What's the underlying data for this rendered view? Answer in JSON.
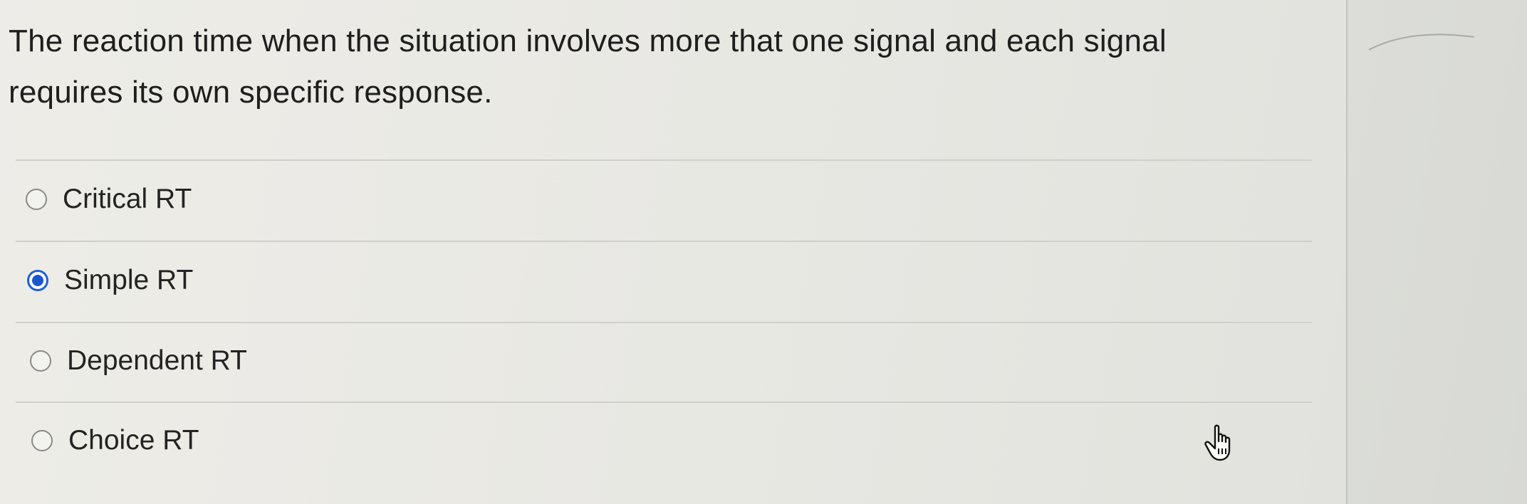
{
  "question": {
    "text": "The reaction time when the situation involves more that one signal and each signal requires its own specific response."
  },
  "options": [
    {
      "label": "Critical RT",
      "selected": false
    },
    {
      "label": "Simple RT",
      "selected": true
    },
    {
      "label": "Dependent RT",
      "selected": false
    },
    {
      "label": "Choice RT",
      "selected": false
    }
  ],
  "icons": {
    "cursor": "hand-pointer-icon",
    "radio_unselected": "radio-empty-icon",
    "radio_selected": "radio-selected-icon"
  },
  "colors": {
    "accent": "#1a56cf",
    "text": "#1e1e1e"
  }
}
